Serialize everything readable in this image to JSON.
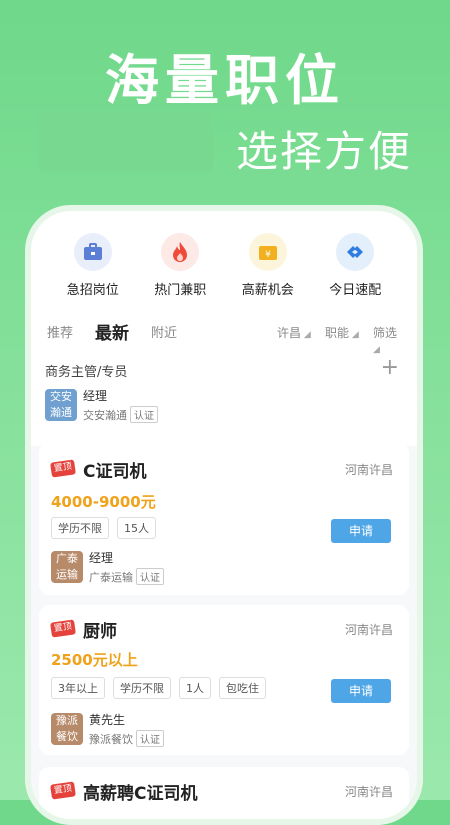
{
  "hero": {
    "title": "海量职位",
    "subtitle": "选择方便"
  },
  "quick_entries": [
    {
      "label": "急招岗位",
      "icon": "briefcase-icon",
      "color": "#5b7fd6",
      "bg": "#e9eefb"
    },
    {
      "label": "热门兼职",
      "icon": "flame-icon",
      "color": "#f04b3a",
      "bg": "#fde9e6"
    },
    {
      "label": "高薪机会",
      "icon": "wallet-icon",
      "color": "#f2b01e",
      "bg": "#fdf4dc"
    },
    {
      "label": "今日速配",
      "icon": "match-icon",
      "color": "#2f7de1",
      "bg": "#e4effc"
    }
  ],
  "tabs": {
    "recommend": "推荐",
    "latest": "最新",
    "nearby": "附近"
  },
  "filters": {
    "city": "许昌",
    "function": "职能",
    "screen": "筛选"
  },
  "subscription": {
    "title": "商务主管/专员",
    "corp_logo_text": "交安\n瀚通",
    "contact": "经理",
    "company": "交安瀚通",
    "auth": "认证",
    "logo_color": "#6fa0d0"
  },
  "jobs": [
    {
      "badge": "置顶",
      "title": "C证司机",
      "location": "河南许昌",
      "salary": "4000-9000元",
      "tags": [
        "学历不限",
        "15人"
      ],
      "apply": "申请",
      "logo_text": "广泰\n运输",
      "logo_color": "#b78a6a",
      "contact": "经理",
      "company": "广泰运输",
      "auth": "认证"
    },
    {
      "badge": "置顶",
      "title": "厨师",
      "location": "河南许昌",
      "salary": "2500元以上",
      "tags": [
        "3年以上",
        "学历不限",
        "1人",
        "包吃住"
      ],
      "apply": "申请",
      "logo_text": "豫派\n餐饮",
      "logo_color": "#b78a6a",
      "contact": "黄先生",
      "company": "豫派餐饮",
      "auth": "认证"
    },
    {
      "badge": "置顶",
      "title": "高薪聘C证司机",
      "location": "河南许昌"
    }
  ]
}
